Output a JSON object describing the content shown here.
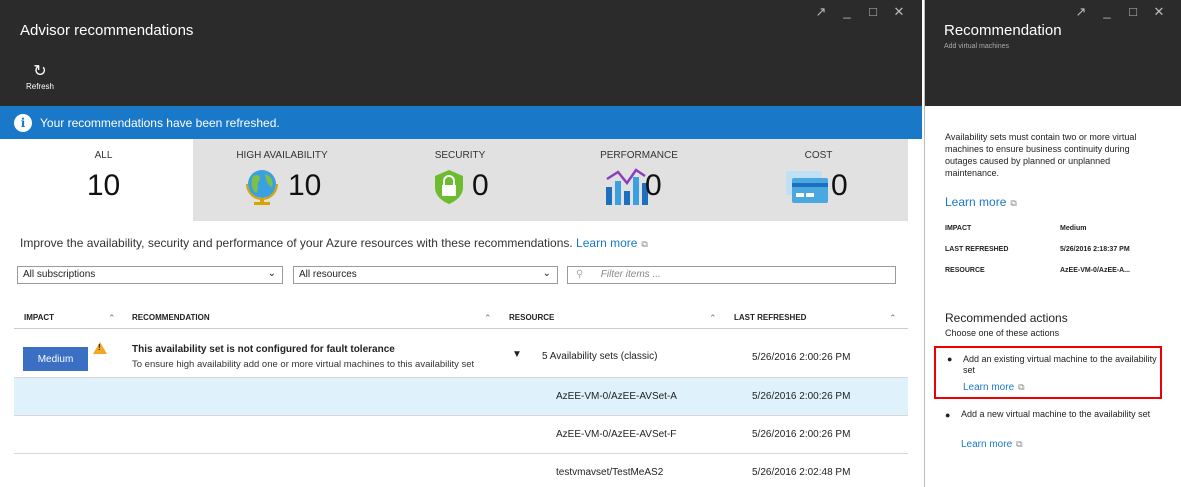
{
  "left_blade": {
    "title": "Advisor recommendations",
    "refresh_label": "Refresh",
    "refresh_icon": "↻",
    "window_controls": [
      "↗",
      "_",
      "□",
      "✕"
    ],
    "notification": "Your recommendations have been refreshed.",
    "tiles": [
      {
        "label": "ALL",
        "count": "10",
        "icon": ""
      },
      {
        "label": "HIGH AVAILABILITY",
        "count": "10",
        "icon": "globe-icon"
      },
      {
        "label": "SECURITY",
        "count": "0",
        "icon": "lock-shield-icon"
      },
      {
        "label": "PERFORMANCE",
        "count": "0",
        "icon": "bar-line-chart-icon"
      },
      {
        "label": "COST",
        "count": "0",
        "icon": "credit-card-icon"
      }
    ],
    "intro_text": "Improve the availability, security and performance of your Azure resources with these recommendations.",
    "intro_link": "Learn more",
    "subscription_filter": "All subscriptions",
    "resource_filter": "All resources",
    "search_placeholder": "Filter items ...",
    "columns": [
      "IMPACT",
      "RECOMMENDATION",
      "RESOURCE",
      "LAST REFRESHED"
    ],
    "main_row": {
      "impact": "Medium",
      "title": "This availability set is not configured for fault tolerance",
      "subtitle": "To ensure high availability add one or more virtual machines to this availability set",
      "resource": "5 Availability sets (classic)",
      "last_refreshed": "5/26/2016 2:00:26 PM"
    },
    "sub_rows": [
      {
        "resource": "AzEE-VM-0/AzEE-AVSet-A",
        "last_refreshed": "5/26/2016 2:00:26 PM"
      },
      {
        "resource": "AzEE-VM-0/AzEE-AVSet-F",
        "last_refreshed": "5/26/2016 2:00:26 PM"
      },
      {
        "resource": "testvmavset/TestMeAS2",
        "last_refreshed": "5/26/2016 2:02:48 PM"
      }
    ]
  },
  "right_blade": {
    "title": "Recommendation",
    "subtitle": "Add virtual machines",
    "window_controls": [
      "↗",
      "_",
      "□",
      "✕"
    ],
    "description": "Availability sets must contain two or more virtual machines to ensure business continuity during outages caused by planned or unplanned maintenance.",
    "learn_more": "Learn more",
    "details": [
      {
        "key": "IMPACT",
        "value": "Medium"
      },
      {
        "key": "LAST REFRESHED",
        "value": "5/26/2016 2:18:37 PM"
      },
      {
        "key": "RESOURCE",
        "value": "AzEE-VM-0/AzEE-A..."
      }
    ],
    "actions_title": "Recommended actions",
    "actions_subtitle": "Choose one of these actions",
    "actions": [
      {
        "text": "Add an existing virtual machine to the availability set",
        "link": "Learn more"
      },
      {
        "text": "Add a new virtual machine to the availability set",
        "link": "Learn more"
      }
    ]
  },
  "colors": {
    "header_bg": "#2b2b2b",
    "accent_blue": "#1a78c9",
    "impact_blue": "#3a6fc4",
    "selected_row": "#dff2fb",
    "highlight_box": "#e00000"
  }
}
